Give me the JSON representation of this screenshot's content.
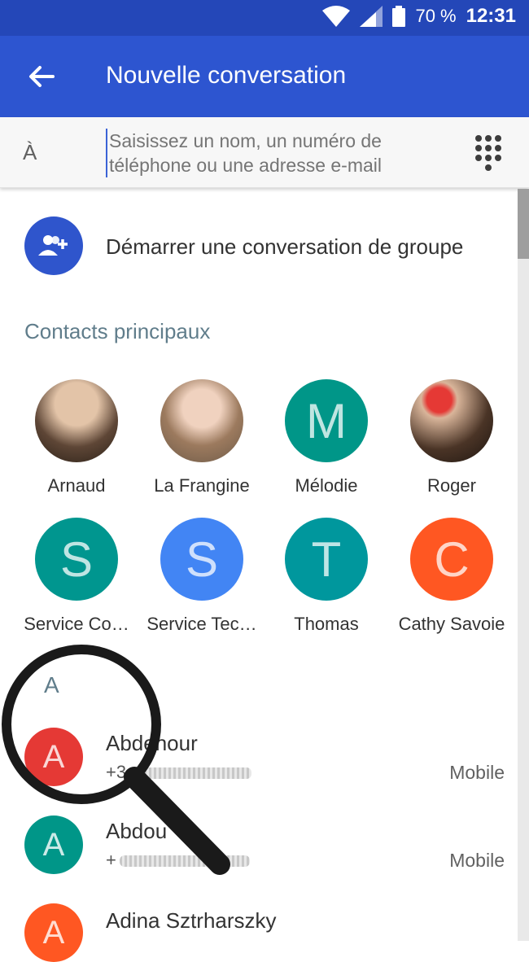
{
  "status": {
    "battery": "70 %",
    "time": "12:31"
  },
  "appbar": {
    "title": "Nouvelle conversation"
  },
  "to": {
    "label": "À",
    "placeholder_line1": "Saisissez un nom, un numéro de",
    "placeholder_line2": "téléphone ou une adresse e-mail"
  },
  "group": {
    "label": "Démarrer une conversation de groupe"
  },
  "top_contacts": {
    "title": "Contacts principaux",
    "items": [
      {
        "name": "Arnaud",
        "letter": "",
        "color": "#8d6e63"
      },
      {
        "name": "La Frangine",
        "letter": "",
        "color": "#a1887f"
      },
      {
        "name": "Mélodie",
        "letter": "M",
        "color": "#009688"
      },
      {
        "name": "Roger",
        "letter": "",
        "color": "#5d4037"
      },
      {
        "name": "Service Co…",
        "letter": "S",
        "color": "#00968f"
      },
      {
        "name": "Service Tec…",
        "letter": "S",
        "color": "#4285f4"
      },
      {
        "name": "Thomas",
        "letter": "T",
        "color": "#00979d"
      },
      {
        "name": "Cathy Savoie",
        "letter": "C",
        "color": "#ff5722"
      }
    ]
  },
  "section_letter": "A",
  "list": [
    {
      "name": "Abdenour",
      "number": "+3",
      "type": "Mobile",
      "letter": "A",
      "color": "#e53935"
    },
    {
      "name": "Abdou",
      "number": "+",
      "type": "Mobile",
      "letter": "A",
      "color": "#009688"
    },
    {
      "name": "Adina Sztrharszky",
      "number": "",
      "type": "",
      "letter": "A",
      "color": "#ff5722"
    }
  ]
}
